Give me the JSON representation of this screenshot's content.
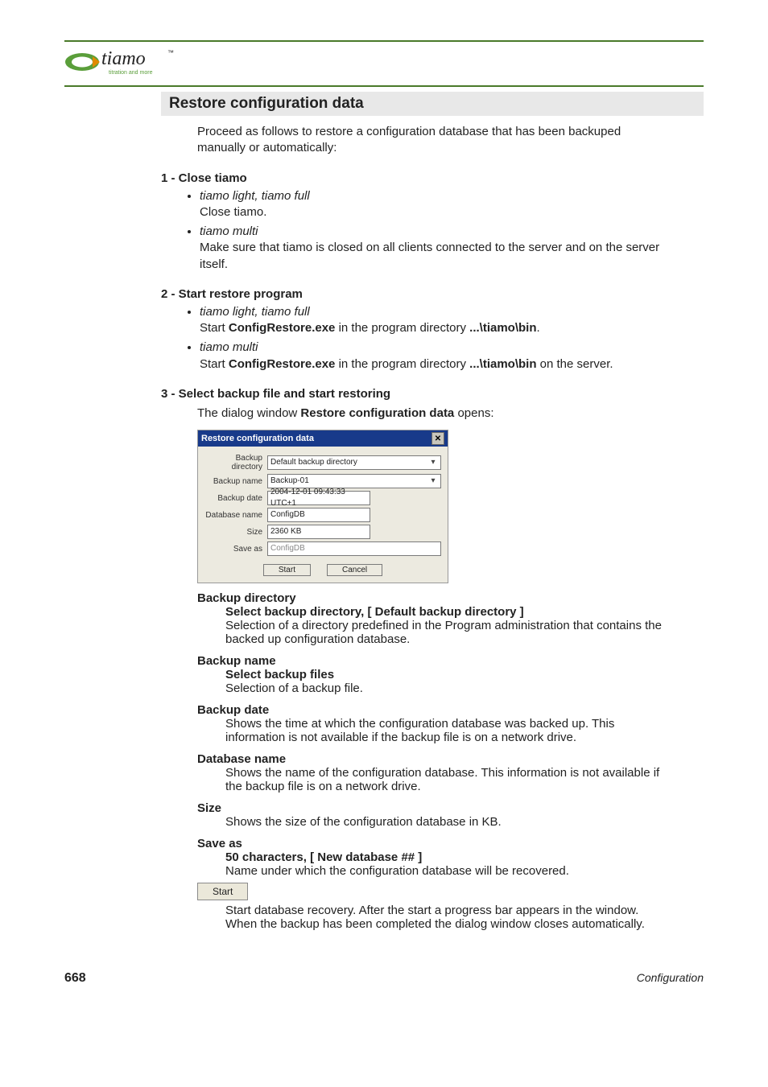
{
  "brand": "tiamo",
  "brand_sub": "titration and more",
  "section_title": "Restore configuration data",
  "intro": "Proceed as follows to restore a configuration database that has been backuped manually or automatically:",
  "step1": {
    "title": "1 - Close tiamo",
    "a_head": "tiamo light, tiamo full",
    "a_body": "Close tiamo.",
    "b_head": "tiamo multi",
    "b_body": "Make sure that tiamo is closed on all clients connected to the server and on the server itself."
  },
  "step2": {
    "title": "2 - Start restore program",
    "a_head": "tiamo light, tiamo full",
    "a_pre": "Start ",
    "a_exe": "ConfigRestore.exe",
    "a_mid": " in the program directory ",
    "a_path": "...\\tiamo\\bin",
    "a_end": ".",
    "b_head": "tiamo multi",
    "b_pre": "Start ",
    "b_exe": "ConfigRestore.exe",
    "b_mid": " in the program directory ",
    "b_path": "...\\tiamo\\bin",
    "b_end": " on the server."
  },
  "step3": {
    "title": "3 - Select backup file and start restoring",
    "intro_pre": "The dialog window ",
    "intro_strong": "Restore configuration data",
    "intro_post": " opens:"
  },
  "dialog": {
    "title": "Restore configuration data",
    "rows": {
      "dirlab": "Backup directory",
      "dirval": "Default backup directory",
      "namelab": "Backup name",
      "nameval": "Backup-01",
      "datelab": "Backup date",
      "dateval": "2004-12-01 09:43:33 UTC+1",
      "dblab": "Database name",
      "dbval": "ConfigDB",
      "sizelab": "Size",
      "sizeval": "2360 KB",
      "savelab": "Save as",
      "saveval": "ConfigDB"
    },
    "start": "Start",
    "cancel": "Cancel"
  },
  "fields": {
    "f1": {
      "label": "Backup directory",
      "sub": "Select backup directory, [ Default backup directory ]",
      "desc": "Selection of a directory predefined in the Program administration that contains the backed up configuration database."
    },
    "f2": {
      "label": "Backup name",
      "sub": "Select backup files",
      "desc": "Selection of a backup file."
    },
    "f3": {
      "label": "Backup date",
      "desc": "Shows the time at which the configuration database was backed up. This information is not available if the backup file is on a network drive."
    },
    "f4": {
      "label": "Database name",
      "desc": "Shows the name of the configuration database. This information is not available if the backup file is on a network drive."
    },
    "f5": {
      "label": "Size",
      "desc": "Shows the size of the configuration database in KB."
    },
    "f6": {
      "label": "Save as",
      "sub": "50 characters, [ New database ## ]",
      "desc": "Name under which the configuration database will be recovered."
    }
  },
  "start_button": "Start",
  "start_desc": "Start database recovery. After the start a progress bar appears in the window. When the backup has been completed the dialog window closes automatically.",
  "page": "668",
  "footer_section": "Configuration"
}
